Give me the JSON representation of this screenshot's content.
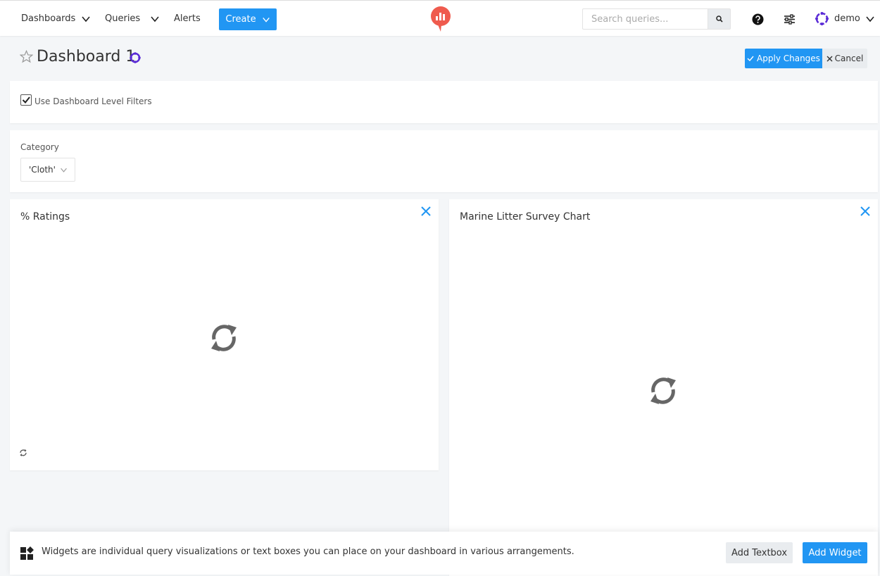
{
  "nav": {
    "dashboards": "Dashboards",
    "queries": "Queries",
    "alerts": "Alerts",
    "create": "Create",
    "search_placeholder": "Search queries...",
    "user": "demo"
  },
  "header": {
    "title": "Dashboard 1",
    "apply_label": "Apply Changes",
    "cancel_label": "Cancel"
  },
  "filters": {
    "use_dashboard_filters_label": "Use Dashboard Level Filters",
    "use_dashboard_filters_checked": true,
    "category_label": "Category",
    "category_value": "'Cloth'"
  },
  "widgets": [
    {
      "title": "% Ratings"
    },
    {
      "title": "Marine Litter Survey Chart"
    }
  ],
  "bottom": {
    "info": "Widgets are individual query visualizations or text boxes you can place on your dashboard in various arrangements.",
    "add_textbox": "Add Textbox",
    "add_widget": "Add Widget"
  },
  "colors": {
    "primary": "#2196f3",
    "logo": "#ef5b4e",
    "accent_purple": "#5a2bd6"
  },
  "icons": [
    "chevron-down-icon",
    "search-icon",
    "help-icon",
    "settings-sliders-icon",
    "star-icon",
    "refresh-icon",
    "close-icon",
    "widgets-icon",
    "check-icon"
  ]
}
